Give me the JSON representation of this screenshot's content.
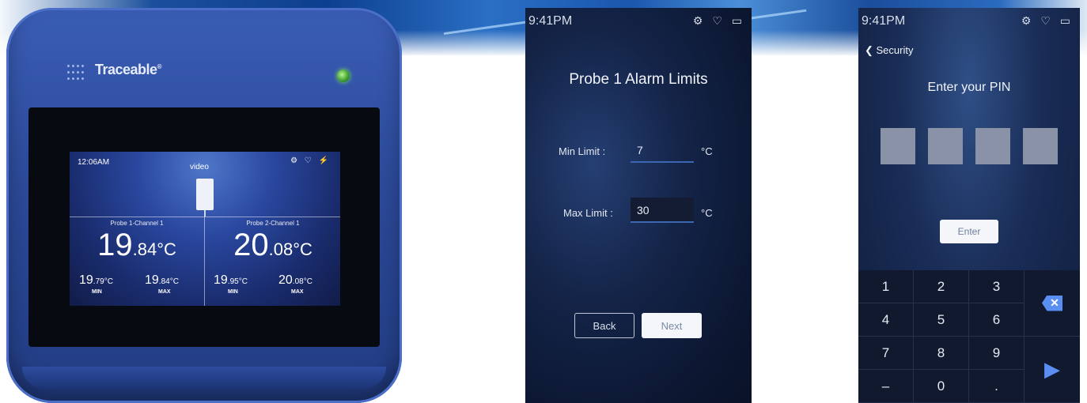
{
  "device": {
    "brand": "Traceable",
    "brand_mark": "®",
    "screen": {
      "time": "12:06AM",
      "video_label": "video",
      "status_icons": "⚙ ♡ ⚡",
      "probes": [
        {
          "label": "Probe 1-Channel 1",
          "value_int": "19",
          "value_dec": ".84",
          "unit": "°C",
          "min_int": "19",
          "min_dec": ".79",
          "max_int": "19",
          "max_dec": ".84",
          "small_unit": "°C",
          "min_label": "MIN",
          "max_label": "MAX"
        },
        {
          "label": "Probe 2-Channel 1",
          "value_int": "20",
          "value_dec": ".08",
          "unit": "°C",
          "min_int": "19",
          "min_dec": ".95",
          "max_int": "20",
          "max_dec": ".08",
          "small_unit": "°C",
          "min_label": "MIN",
          "max_label": "MAX"
        }
      ]
    }
  },
  "alarm_screen": {
    "time": "9:41PM",
    "status_icons": "⚙ ♡ ▭",
    "title": "Probe 1 Alarm Limits",
    "min_label": "Min Limit :",
    "min_value": "7",
    "max_label": "Max Limit :",
    "max_value": "30",
    "unit": "°C",
    "back_label": "Back",
    "next_label": "Next"
  },
  "pin_screen": {
    "time": "9:41PM",
    "status_icons": "⚙ ♡ ▭",
    "back_label": "Security",
    "title": "Enter your PIN",
    "enter_label": "Enter",
    "keys": [
      "1",
      "2",
      "3",
      "4",
      "5",
      "6",
      "7",
      "8",
      "9",
      "–",
      "0",
      "."
    ],
    "backspace_icon": "✕",
    "send_icon": "▶"
  },
  "colors": {
    "device_blue": "#2c4a9a",
    "accent_blue": "#5a8ef0",
    "led_green": "#3a9b2e"
  }
}
